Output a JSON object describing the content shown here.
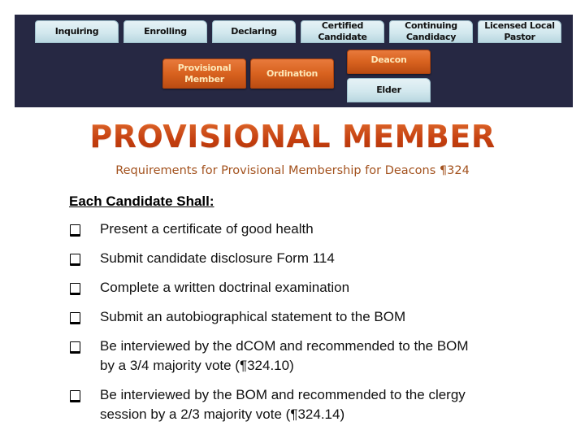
{
  "nav": {
    "top_row": [
      {
        "id": "inquiring",
        "label": "Inquiring"
      },
      {
        "id": "enrolling",
        "label": "Enrolling"
      },
      {
        "id": "declaring",
        "label": "Declaring"
      },
      {
        "id": "certified",
        "label": "Certified Candidate"
      },
      {
        "id": "continuing",
        "label": "Continuing Candidacy"
      },
      {
        "id": "licensed",
        "label": "Licensed Local Pastor"
      }
    ],
    "bottom_row": [
      {
        "id": "provisional",
        "label": "Provisional Member",
        "state": "active"
      },
      {
        "id": "ordination",
        "label": "Ordination",
        "state": "active"
      },
      {
        "id": "deacon",
        "label": "Deacon",
        "state": "active"
      },
      {
        "id": "elder",
        "label": "Elder",
        "state": "inactive"
      }
    ],
    "colors": {
      "banner": "#262843",
      "active": "#d8621f",
      "inactive": "#d2e8ee"
    }
  },
  "page": {
    "title": "PROVISIONAL MEMBER",
    "subtitle": "Requirements for Provisional Membership for Deacons ¶324",
    "section_heading": "Each Candidate Shall:",
    "requirements": [
      "Present a certificate of good health",
      "Submit candidate disclosure Form 114",
      "Complete a written doctrinal examination",
      "Submit an autobiographical statement to the BOM",
      "Be interviewed by the dCOM and recommended to the BOM by a 3/4 majority vote (¶324.10)",
      "Be interviewed by the BOM and recommended to the clergy session by a 2/3 majority vote (¶324.14)"
    ],
    "bullet_icon": "checkbox-icon",
    "colors": {
      "title": "#d9531a",
      "subtitle": "#a3521e"
    }
  }
}
